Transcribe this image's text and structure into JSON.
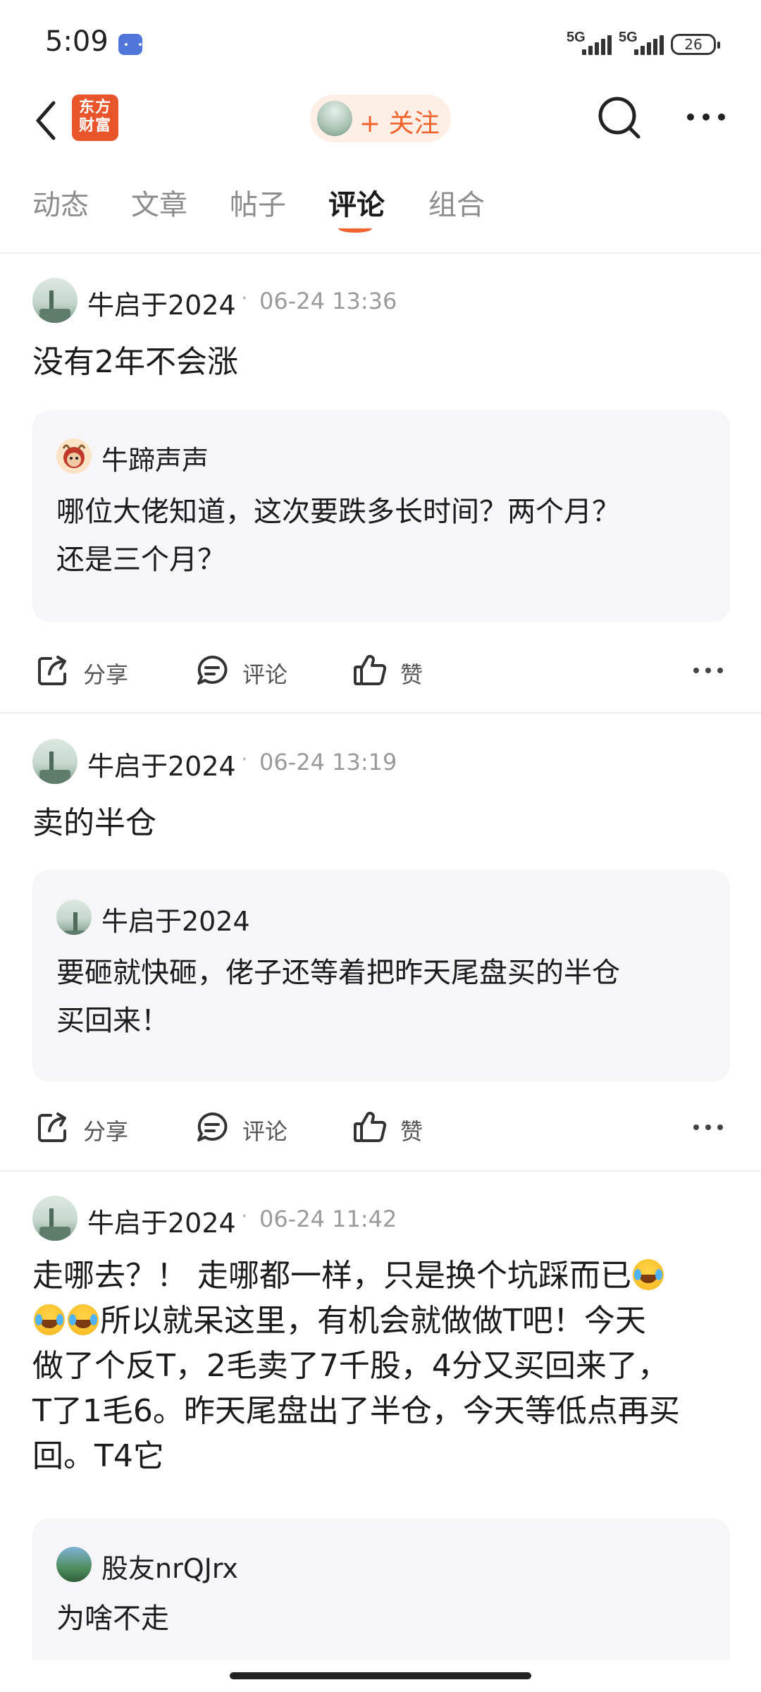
{
  "status_bar": {
    "time": "5:09",
    "signal1": "5G",
    "signal2": "5G",
    "battery": "26"
  },
  "header": {
    "brand_logo": "东方财富",
    "follow_label": "+ 关注"
  },
  "tabs": [
    "动态",
    "文章",
    "帖子",
    "评论",
    "组合"
  ],
  "active_tab": "评论",
  "colors": {
    "accent": "#f2622c",
    "quote_bg": "#f6f6f8"
  },
  "posts": [
    {
      "author": "牛启于2024",
      "time": "06-24 13:36",
      "text": "没有2年不会涨",
      "quote": {
        "author": "牛蹄声声",
        "lines": [
          "哪位大佬知道，这次要跌多长时间？两个月？",
          "还是三个月？"
        ]
      }
    },
    {
      "author": "牛启于2024",
      "time": "06-24 13:19",
      "text": "卖的半仓",
      "quote": {
        "author": "牛启于2024",
        "lines": [
          "要砸就快砸，佬子还等着把昨天尾盘买的半仓",
          "买回来！"
        ]
      }
    },
    {
      "author": "牛启于2024",
      "time": "06-24 11:42",
      "text_lines": [
        "走哪去？！ 走哪都一样，只是换个坑踩而已",
        "所以就呆这里，有机会就做做T吧！今天",
        "做了个反T，2毛卖了7千股，4分又买回来了，",
        "T了1毛6。昨天尾盘出了半仓，今天等低点再买",
        "回。T4它"
      ],
      "quote": {
        "author": "股友nrQJrx",
        "lines": [
          "为啥不走"
        ]
      }
    }
  ],
  "actions": {
    "share": "分享",
    "comment": "评论",
    "like": "赞"
  }
}
